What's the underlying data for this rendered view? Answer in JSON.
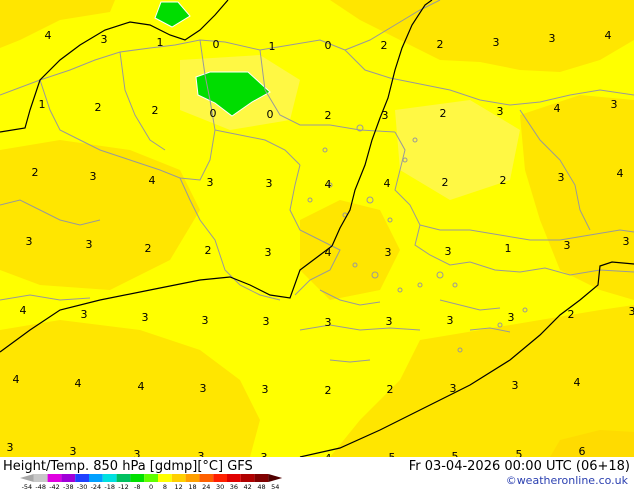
{
  "header": {
    "left_title": "Height/Temp. 850 hPa [gdmp][°C] GFS",
    "right_title": "Fr 03-04-2026 00:00 UTC (06+18)",
    "credit": "©weatheronline.co.uk"
  },
  "colors": {
    "field_main": "#ffff00",
    "field_warm": "#ffe600",
    "field_light": "#fff844",
    "cold_patch": "#00dd00",
    "border_lines": "#999999",
    "contour": "#000000",
    "credit": "#2a3fb0"
  },
  "colorbar": {
    "labels": [
      "-54",
      "-48",
      "-42",
      "-38",
      "-30",
      "-24",
      "-18",
      "-12",
      "-8",
      "0",
      "8",
      "12",
      "18",
      "24",
      "30",
      "36",
      "42",
      "48",
      "54"
    ],
    "colors": [
      "#a8a8a8",
      "#c8c8c8",
      "#e000e0",
      "#a000d8",
      "#2040ff",
      "#00a0ff",
      "#00e0e0",
      "#00c060",
      "#00e000",
      "#60ff00",
      "#ffff00",
      "#ffd000",
      "#ffa000",
      "#ff6000",
      "#ff2000",
      "#e00000",
      "#b00000",
      "#800000",
      "#500000"
    ]
  },
  "temperature_labels": [
    {
      "v": "4"
    },
    {
      "v": "3"
    },
    {
      "v": "1"
    },
    {
      "v": "0"
    },
    {
      "v": "1"
    },
    {
      "v": "0"
    },
    {
      "v": "2"
    },
    {
      "v": "2"
    },
    {
      "v": "3"
    },
    {
      "v": "3"
    },
    {
      "v": "4"
    },
    {
      "v": "1"
    },
    {
      "v": "2"
    },
    {
      "v": "2"
    },
    {
      "v": "0"
    },
    {
      "v": "0"
    },
    {
      "v": "2"
    },
    {
      "v": "3"
    },
    {
      "v": "2"
    },
    {
      "v": "3"
    },
    {
      "v": "4"
    },
    {
      "v": "3"
    },
    {
      "v": "2"
    },
    {
      "v": "3"
    },
    {
      "v": "4"
    },
    {
      "v": "3"
    },
    {
      "v": "3"
    },
    {
      "v": "4"
    },
    {
      "v": "4"
    },
    {
      "v": "2"
    },
    {
      "v": "2"
    },
    {
      "v": "3"
    },
    {
      "v": "4"
    },
    {
      "v": "3"
    },
    {
      "v": "3"
    },
    {
      "v": "2"
    },
    {
      "v": "2"
    },
    {
      "v": "3"
    },
    {
      "v": "4"
    },
    {
      "v": "3"
    },
    {
      "v": "3"
    },
    {
      "v": "1"
    },
    {
      "v": "3"
    },
    {
      "v": "3"
    },
    {
      "v": "4"
    },
    {
      "v": "3"
    },
    {
      "v": "3"
    },
    {
      "v": "3"
    },
    {
      "v": "3"
    },
    {
      "v": "3"
    },
    {
      "v": "3"
    },
    {
      "v": "3"
    },
    {
      "v": "3"
    },
    {
      "v": "2"
    },
    {
      "v": "3"
    },
    {
      "v": "4"
    },
    {
      "v": "4"
    },
    {
      "v": "4"
    },
    {
      "v": "3"
    },
    {
      "v": "3"
    },
    {
      "v": "2"
    },
    {
      "v": "2"
    },
    {
      "v": "3"
    },
    {
      "v": "3"
    },
    {
      "v": "4"
    },
    {
      "v": "3"
    },
    {
      "v": "3"
    },
    {
      "v": "3"
    },
    {
      "v": "3"
    },
    {
      "v": "3"
    },
    {
      "v": "4"
    },
    {
      "v": "5"
    },
    {
      "v": "5"
    },
    {
      "v": "5"
    },
    {
      "v": "6"
    }
  ]
}
